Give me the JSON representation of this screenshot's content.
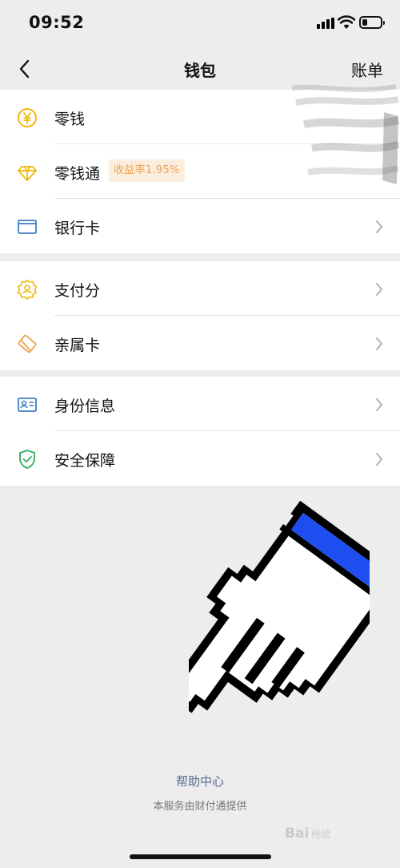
{
  "status_bar": {
    "time": "09:52"
  },
  "nav": {
    "title": "钱包",
    "right_label": "账单"
  },
  "groups": [
    {
      "items": [
        {
          "label": "零钱",
          "icon": "yuan-coin-icon"
        },
        {
          "label": "零钱通",
          "icon": "diamond-icon",
          "badge": "收益率1.95%"
        },
        {
          "label": "银行卡",
          "icon": "bank-card-icon"
        }
      ]
    },
    {
      "items": [
        {
          "label": "支付分",
          "icon": "score-badge-icon"
        },
        {
          "label": "亲属卡",
          "icon": "family-card-icon"
        }
      ]
    },
    {
      "items": [
        {
          "label": "身份信息",
          "icon": "id-card-icon"
        },
        {
          "label": "安全保障",
          "icon": "shield-icon"
        }
      ]
    }
  ],
  "footer": {
    "help_link": "帮助中心",
    "note": "本服务由财付通提供"
  },
  "watermark": {
    "text": "Bai",
    "sub": "经验"
  },
  "colors": {
    "accent_yellow": "#f2b705",
    "accent_blue": "#3b7fc4",
    "accent_green": "#2bad5b",
    "link_blue": "#576b95",
    "cursor_blue": "#1f4ef0"
  }
}
